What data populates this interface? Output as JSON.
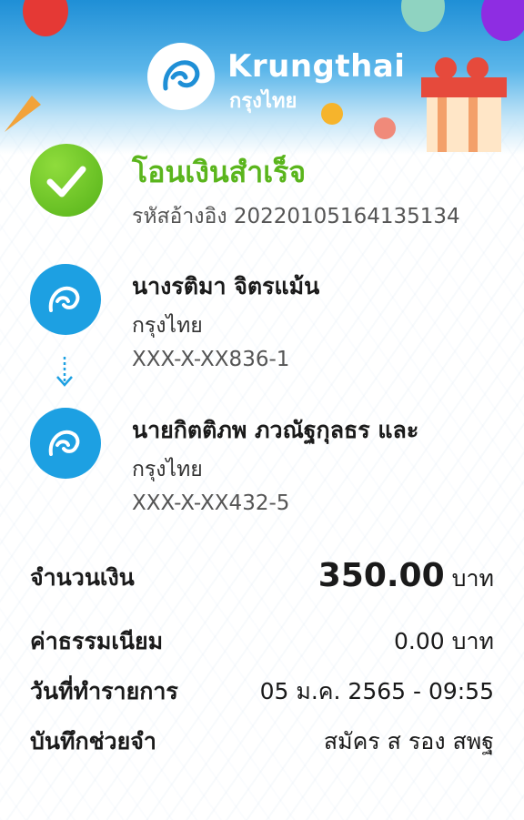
{
  "brand": {
    "name_en": "Krungthai",
    "name_th": "กรุงไทย"
  },
  "status": {
    "title": "โอนเงินสำเร็จ",
    "reference": "รหัสอ้างอิง 2022010516413513​4"
  },
  "sender": {
    "name": "นางรติมา จิตรแม้น",
    "bank": "กรุงไทย",
    "account": "XXX-X-XX836-1"
  },
  "receiver": {
    "name": "นายกิตติภพ ภวณัฐกุลธร และ",
    "bank": "กรุงไทย",
    "account": "XXX-X-XX432-5"
  },
  "details": {
    "amount_label": "จำนวนเงิน",
    "amount_value": "350.00",
    "amount_unit": "บาท",
    "fee_label": "ค่าธรรมเนียม",
    "fee_value": "0.00 บาท",
    "date_label": "วันที่ทำรายการ",
    "date_value": "05 ม.ค. 2565 - 09:55",
    "memo_label": "บันทึกช่วยจำ",
    "memo_value": "สมัคร ส รอง สพฐ"
  },
  "colors": {
    "success": "#5ab51c",
    "brand_blue": "#1da0e2",
    "header_blue": "#1f8fd6"
  },
  "icons": [
    "krungthai-logo-icon",
    "check-icon",
    "arrow-down-icon",
    "balloon-icon",
    "gift-icon",
    "party-popper-icon"
  ]
}
